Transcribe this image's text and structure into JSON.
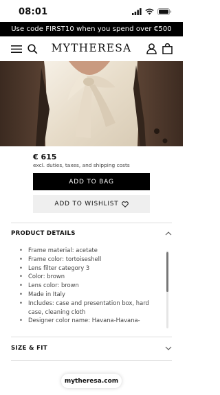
{
  "status_bar": {
    "time": "08:01"
  },
  "promo": {
    "text": "Use code FIRST10 when you spend over €500"
  },
  "header": {
    "logo": "MYTHERESA",
    "icons": [
      "menu-icon",
      "search-icon",
      "account-icon",
      "bag-icon"
    ]
  },
  "product": {
    "price": "€ 615",
    "price_note": "excl. duties, taxes, and shipping costs",
    "add_to_bag": "ADD TO BAG",
    "add_to_wishlist": "ADD TO WISHLIST"
  },
  "sections": {
    "product_details": {
      "title": "PRODUCT DETAILS",
      "expanded": true,
      "items": [
        "Frame material: acetate",
        "Frame color: tortoiseshell",
        "Lens filter category 3",
        "Color: brown",
        "Lens color: brown",
        "Made in Italy",
        "Includes: case and presentation box, hard case, cleaning cloth",
        "Designer color name: Havana-Havana-"
      ]
    },
    "size_fit": {
      "title": "SIZE & FIT",
      "expanded": false
    }
  },
  "browser": {
    "url": "mytheresa.com"
  },
  "colors": {
    "promo_bg": "#000000",
    "primary_button": "#000000",
    "secondary_button": "#efefef",
    "divider": "#dcdcdc"
  }
}
